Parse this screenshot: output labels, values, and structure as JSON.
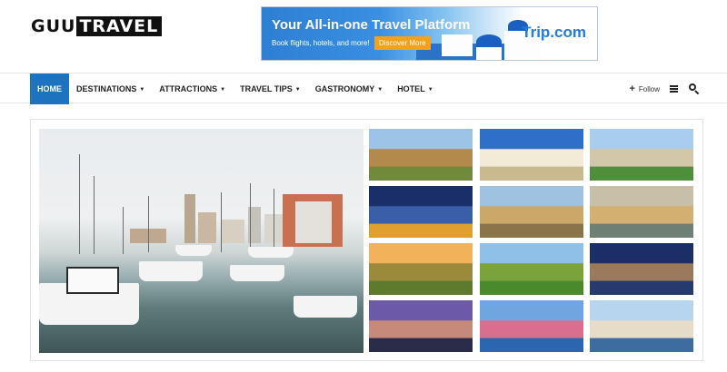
{
  "logo": {
    "part1": "GUU",
    "part2": "TRAVEL"
  },
  "banner": {
    "headline": "Your All-in-one Travel Platform",
    "sub": "Book flights, hotels, and more!",
    "cta": "Discover More",
    "brand": "Trip.com"
  },
  "nav": {
    "items": [
      {
        "label": "HOME",
        "active": true,
        "dropdown": false
      },
      {
        "label": "DESTINATIONS",
        "active": false,
        "dropdown": true
      },
      {
        "label": "ATTRACTIONS",
        "active": false,
        "dropdown": true
      },
      {
        "label": "TRAVEL TIPS",
        "active": false,
        "dropdown": true
      },
      {
        "label": "GASTRONOMY",
        "active": false,
        "dropdown": true
      },
      {
        "label": "HOTEL",
        "active": false,
        "dropdown": true
      }
    ],
    "follow_label": "Follow",
    "icons": {
      "plus": "plus-icon",
      "menu": "hamburger-menu-icon",
      "search": "search-icon"
    }
  },
  "colors": {
    "accent": "#1e73be",
    "text": "#222222",
    "banner_cta": "#f5a11b"
  },
  "gallery": {
    "thumbs": [
      {
        "name": "thumb-cotswolds-village",
        "sky": "#9dc3e6",
        "land": "#b48a4c",
        "ground": "#6f8a3a"
      },
      {
        "name": "thumb-brighton-pavilion",
        "sky": "#2f6ec9",
        "land": "#f3ead8",
        "ground": "#c9b98f"
      },
      {
        "name": "thumb-cambridge-river",
        "sky": "#a9cdee",
        "land": "#d2c7a8",
        "ground": "#4d8f3b"
      },
      {
        "name": "thumb-london-night",
        "sky": "#1a2f6a",
        "land": "#3b5ea8",
        "ground": "#e0a030"
      },
      {
        "name": "thumb-oxford-spires",
        "sky": "#9fc2e0",
        "land": "#c9a86a",
        "ground": "#8a7449"
      },
      {
        "name": "thumb-bath-bridge",
        "sky": "#c7bfa8",
        "land": "#d3b071",
        "ground": "#6e7f75"
      },
      {
        "name": "thumb-countryside-sunset",
        "sky": "#f1b25a",
        "land": "#9a8a3a",
        "ground": "#5e7a2c"
      },
      {
        "name": "thumb-bibury-cottages",
        "sky": "#8fc0e8",
        "land": "#7aa33c",
        "ground": "#4b8a2c"
      },
      {
        "name": "thumb-manchester-townhall",
        "sky": "#1b2f66",
        "land": "#9a7a5a",
        "ground": "#263a6e"
      },
      {
        "name": "thumb-liverpool-liver-building",
        "sky": "#6c5aa8",
        "land": "#c58a7a",
        "ground": "#2b2b4a"
      },
      {
        "name": "thumb-tobermory-harbour",
        "sky": "#6fa6df",
        "land": "#d96e8e",
        "ground": "#2c66b0"
      },
      {
        "name": "thumb-york-riverside",
        "sky": "#b7d5ef",
        "land": "#e6dcc8",
        "ground": "#3d6da0"
      }
    ]
  }
}
